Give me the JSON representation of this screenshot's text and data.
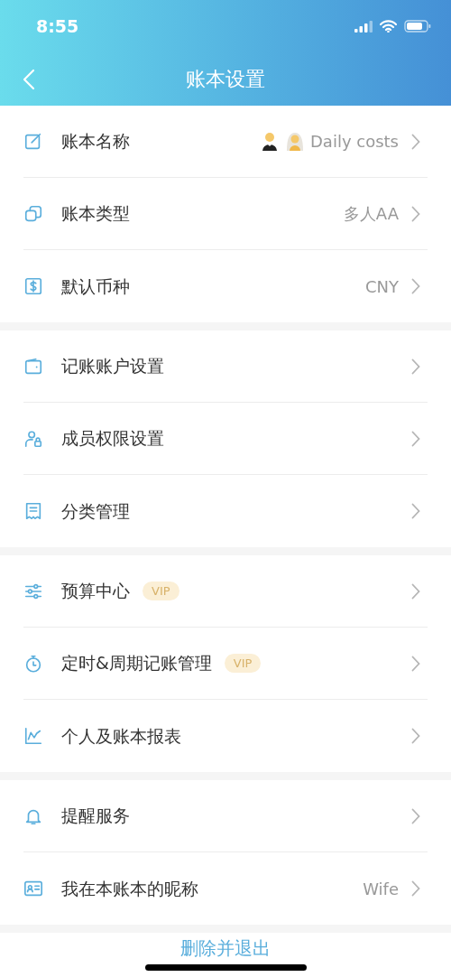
{
  "status_bar": {
    "time": "8:55"
  },
  "nav": {
    "title": "账本设置"
  },
  "sections": [
    {
      "items": [
        {
          "label": "账本名称",
          "value": "Daily costs"
        },
        {
          "label": "账本类型",
          "value": "多人AA"
        },
        {
          "label": "默认币种",
          "value": "CNY"
        }
      ]
    },
    {
      "items": [
        {
          "label": "记账账户设置"
        },
        {
          "label": "成员权限设置"
        },
        {
          "label": "分类管理"
        }
      ]
    },
    {
      "items": [
        {
          "label": "预算中心",
          "badge": "VIP"
        },
        {
          "label": "定时&周期记账管理",
          "badge": "VIP"
        },
        {
          "label": "个人及账本报表"
        }
      ]
    },
    {
      "items": [
        {
          "label": "提醒服务"
        },
        {
          "label": "我在本账本的昵称",
          "value": "Wife"
        }
      ]
    }
  ],
  "bottom_action": "删除并退出"
}
